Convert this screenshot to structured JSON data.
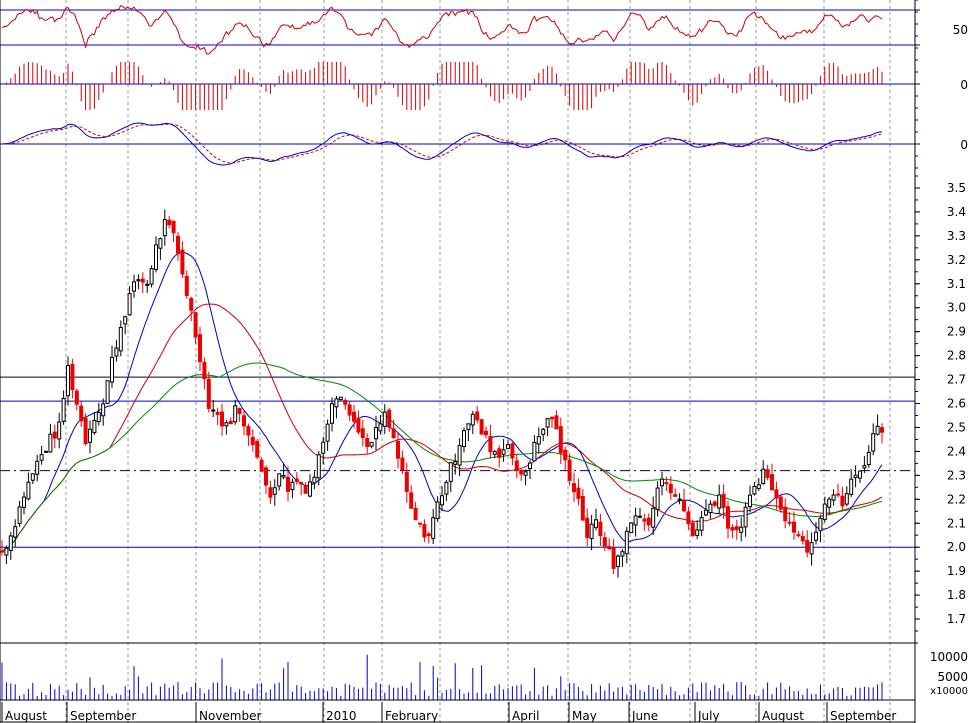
{
  "colors": {
    "rsi": "#cc0000",
    "histogram": "#cc0000",
    "macd": "#0000cc",
    "signal": "#cc0000",
    "ma_short": "#0000cc",
    "ma_mid": "#cc0000",
    "ma_long": "#008800",
    "up_candle": "#000000",
    "down_candle": "#ee0000",
    "hline": "#0000cc",
    "dashline": "#000066",
    "volume": "#0000cc",
    "grid": "#999999"
  },
  "panels": {
    "rsi": {
      "tick_labels": [
        "50"
      ]
    },
    "histogram": {
      "tick_labels": [
        "0"
      ]
    },
    "macd": {
      "tick_labels": [
        "0"
      ]
    },
    "volume": {
      "tick_labels": [
        "10000",
        "5000"
      ],
      "unit_label": "x10000"
    }
  },
  "chart_data": {
    "type": "candlestick",
    "x_tick_labels": [
      "August",
      "September",
      "November",
      "2010",
      "February",
      "April",
      "May",
      "June",
      "July",
      "August",
      "September"
    ],
    "price_axis": {
      "ylim": [
        1.6,
        3.55
      ],
      "tick_labels": [
        "3.5",
        "3.4",
        "3.3",
        "3.2",
        "3.1",
        "3.0",
        "2.9",
        "2.8",
        "2.7",
        "2.6",
        "2.5",
        "2.4",
        "2.3",
        "2.2",
        "2.1",
        "2.0",
        "1.9",
        "1.8",
        "1.7"
      ],
      "ticks": [
        3.5,
        3.4,
        3.3,
        3.2,
        3.1,
        3.0,
        2.9,
        2.8,
        2.7,
        2.6,
        2.5,
        2.4,
        2.3,
        2.2,
        2.1,
        2.0,
        1.9,
        1.8,
        1.7
      ]
    },
    "horizontal_levels": [
      {
        "value": 2.71,
        "style": "solid"
      },
      {
        "value": 2.61,
        "style": "solid"
      },
      {
        "value": 2.32,
        "style": "dash-dot"
      },
      {
        "value": 2.0,
        "style": "solid"
      }
    ],
    "close_anchors": [
      [
        0,
        1.98
      ],
      [
        4,
        2.05
      ],
      [
        10,
        2.22
      ],
      [
        16,
        2.35
      ],
      [
        22,
        2.45
      ],
      [
        26,
        2.5
      ],
      [
        30,
        2.75
      ],
      [
        34,
        2.6
      ],
      [
        38,
        2.45
      ],
      [
        42,
        2.55
      ],
      [
        46,
        2.6
      ],
      [
        50,
        2.78
      ],
      [
        54,
        2.92
      ],
      [
        58,
        3.05
      ],
      [
        62,
        3.12
      ],
      [
        66,
        3.1
      ],
      [
        70,
        3.25
      ],
      [
        74,
        3.35
      ],
      [
        78,
        3.3
      ],
      [
        82,
        3.15
      ],
      [
        86,
        2.98
      ],
      [
        90,
        2.8
      ],
      [
        94,
        2.6
      ],
      [
        98,
        2.55
      ],
      [
        102,
        2.5
      ],
      [
        106,
        2.58
      ],
      [
        110,
        2.52
      ],
      [
        114,
        2.45
      ],
      [
        118,
        2.3
      ],
      [
        122,
        2.22
      ],
      [
        126,
        2.32
      ],
      [
        130,
        2.25
      ],
      [
        134,
        2.28
      ],
      [
        138,
        2.25
      ],
      [
        142,
        2.3
      ],
      [
        146,
        2.45
      ],
      [
        150,
        2.62
      ],
      [
        154,
        2.65
      ],
      [
        158,
        2.55
      ],
      [
        162,
        2.5
      ],
      [
        166,
        2.4
      ],
      [
        170,
        2.48
      ],
      [
        174,
        2.55
      ],
      [
        178,
        2.45
      ],
      [
        182,
        2.3
      ],
      [
        186,
        2.15
      ],
      [
        190,
        2.08
      ],
      [
        194,
        2.05
      ],
      [
        198,
        2.18
      ],
      [
        202,
        2.28
      ],
      [
        206,
        2.38
      ],
      [
        210,
        2.5
      ],
      [
        214,
        2.55
      ],
      [
        218,
        2.48
      ],
      [
        222,
        2.42
      ],
      [
        226,
        2.38
      ],
      [
        230,
        2.45
      ],
      [
        234,
        2.3
      ],
      [
        238,
        2.32
      ],
      [
        242,
        2.42
      ],
      [
        246,
        2.5
      ],
      [
        250,
        2.55
      ],
      [
        254,
        2.4
      ],
      [
        258,
        2.3
      ],
      [
        262,
        2.2
      ],
      [
        266,
        2.05
      ],
      [
        270,
        2.1
      ],
      [
        274,
        2.02
      ],
      [
        278,
        1.92
      ],
      [
        282,
        2.0
      ],
      [
        286,
        2.1
      ],
      [
        290,
        2.15
      ],
      [
        294,
        2.08
      ],
      [
        298,
        2.25
      ],
      [
        302,
        2.28
      ],
      [
        306,
        2.22
      ],
      [
        310,
        2.15
      ],
      [
        314,
        2.05
      ],
      [
        318,
        2.12
      ],
      [
        322,
        2.18
      ],
      [
        326,
        2.22
      ],
      [
        330,
        2.1
      ],
      [
        334,
        2.05
      ],
      [
        338,
        2.15
      ],
      [
        342,
        2.25
      ],
      [
        346,
        2.32
      ],
      [
        350,
        2.25
      ],
      [
        354,
        2.15
      ],
      [
        358,
        2.12
      ],
      [
        362,
        2.05
      ],
      [
        366,
        2.0
      ],
      [
        370,
        2.08
      ],
      [
        374,
        2.2
      ],
      [
        378,
        2.22
      ],
      [
        382,
        2.18
      ],
      [
        386,
        2.27
      ],
      [
        390,
        2.32
      ],
      [
        394,
        2.4
      ],
      [
        398,
        2.52
      ],
      [
        400,
        2.5
      ]
    ],
    "moving_average_periods": [
      20,
      50,
      100
    ],
    "indicator_levels": {
      "rsi_reference": [
        50,
        70
      ],
      "macd_zero": 0
    }
  }
}
